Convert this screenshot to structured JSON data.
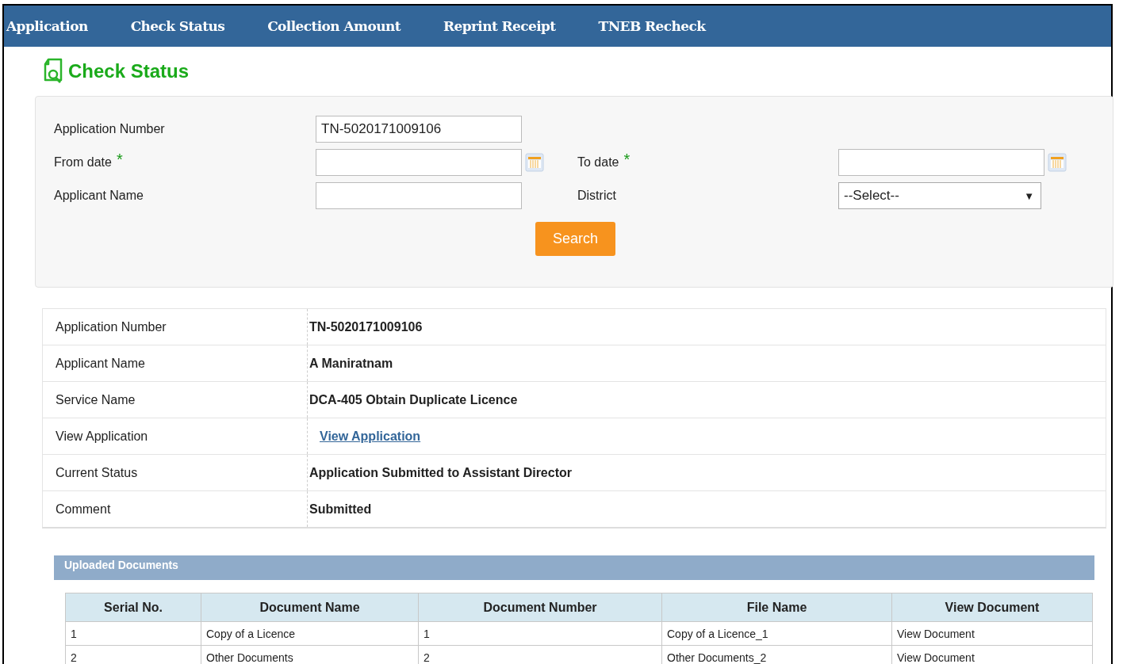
{
  "nav": [
    {
      "label": "Application",
      "selected": false
    },
    {
      "label": "Check Status",
      "selected": false
    },
    {
      "label": "Collection Amount",
      "selected": false
    },
    {
      "label": "Reprint Receipt",
      "selected": false
    },
    {
      "label": "TNEB Recheck",
      "selected": false
    }
  ],
  "page_title": "Check Status",
  "search_form": {
    "fields": [
      {
        "label": "Application Number",
        "kind": "text",
        "value": "TN-5020171009106"
      },
      {
        "label": "From date",
        "kind": "date",
        "required_mark": "*"
      },
      {
        "label": "To date",
        "kind": "date",
        "required_mark": "*"
      },
      {
        "label": "Applicant Name",
        "kind": "text"
      },
      {
        "label": "District",
        "kind": "select",
        "value": "--Select--",
        "caret": "▼"
      }
    ],
    "button": "Search"
  },
  "details": [
    {
      "label": "Application Number",
      "value": "TN-5020171009106",
      "kind": "text"
    },
    {
      "label": "Applicant Name",
      "value": "A Maniratnam",
      "kind": "text"
    },
    {
      "label": "Service Name",
      "value": "DCA-405 Obtain Duplicate Licence",
      "kind": "text"
    },
    {
      "label": "View Application",
      "value": "View Application",
      "kind": "link"
    },
    {
      "label": "Current Status",
      "value": "Application Submitted to Assistant Director",
      "kind": "text"
    },
    {
      "label": "Comment",
      "value": "Submitted",
      "kind": "text"
    }
  ],
  "uploaded_documents": {
    "title": "Uploaded Documents",
    "columns": [
      "Serial No.",
      "Document Name",
      "Document Number",
      "File Name",
      "View Document"
    ],
    "rows": [
      [
        "1",
        "Copy of a Licence",
        "1",
        "Copy of a Licence_1",
        "View Document"
      ],
      [
        "2",
        "Other Documents",
        "2",
        "Other Documents_2",
        "View Document"
      ]
    ]
  }
}
